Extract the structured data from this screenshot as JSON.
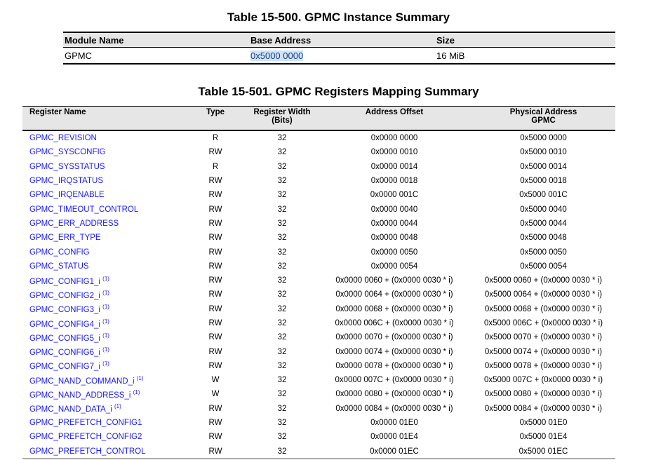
{
  "instance_table": {
    "title": "Table 15-500. GPMC Instance Summary",
    "headers": [
      "Module Name",
      "Base Address",
      "Size"
    ],
    "row": {
      "module": "GPMC",
      "base": "0x5000 0000",
      "size": "16 MiB"
    }
  },
  "mapping_table": {
    "title": "Table 15-501. GPMC Registers Mapping Summary",
    "headers": {
      "name": "Register Name",
      "type": "Type",
      "width_1": "Register Width",
      "width_2": "(Bits)",
      "offset": "Address Offset",
      "phys_1": "Physical Address",
      "phys_2": "GPMC"
    },
    "footnote_mark": "(1)",
    "rows": [
      {
        "name": "GPMC_REVISION",
        "fn": false,
        "type": "R",
        "width": "32",
        "offset": "0x0000 0000",
        "phys": "0x5000 0000"
      },
      {
        "name": "GPMC_SYSCONFIG",
        "fn": false,
        "type": "RW",
        "width": "32",
        "offset": "0x0000 0010",
        "phys": "0x5000 0010"
      },
      {
        "name": "GPMC_SYSSTATUS",
        "fn": false,
        "type": "R",
        "width": "32",
        "offset": "0x0000 0014",
        "phys": "0x5000 0014"
      },
      {
        "name": "GPMC_IRQSTATUS",
        "fn": false,
        "type": "RW",
        "width": "32",
        "offset": "0x0000 0018",
        "phys": "0x5000 0018"
      },
      {
        "name": "GPMC_IRQENABLE",
        "fn": false,
        "type": "RW",
        "width": "32",
        "offset": "0x0000 001C",
        "phys": "0x5000 001C"
      },
      {
        "name": "GPMC_TIMEOUT_CONTROL",
        "fn": false,
        "type": "RW",
        "width": "32",
        "offset": "0x0000 0040",
        "phys": "0x5000 0040"
      },
      {
        "name": "GPMC_ERR_ADDRESS",
        "fn": false,
        "type": "RW",
        "width": "32",
        "offset": "0x0000 0044",
        "phys": "0x5000 0044"
      },
      {
        "name": "GPMC_ERR_TYPE",
        "fn": false,
        "type": "RW",
        "width": "32",
        "offset": "0x0000 0048",
        "phys": "0x5000 0048"
      },
      {
        "name": "GPMC_CONFIG",
        "fn": false,
        "type": "RW",
        "width": "32",
        "offset": "0x0000 0050",
        "phys": "0x5000 0050"
      },
      {
        "name": "GPMC_STATUS",
        "fn": false,
        "type": "RW",
        "width": "32",
        "offset": "0x0000 0054",
        "phys": "0x5000 0054"
      },
      {
        "name": "GPMC_CONFIG1_i",
        "fn": true,
        "type": "RW",
        "width": "32",
        "offset": "0x0000 0060 + (0x0000 0030 * i)",
        "phys": "0x5000 0060 + (0x0000 0030 * i)"
      },
      {
        "name": "GPMC_CONFIG2_i",
        "fn": true,
        "type": "RW",
        "width": "32",
        "offset": "0x0000 0064 + (0x0000 0030 * i)",
        "phys": "0x5000 0064 + (0x0000 0030 * i)"
      },
      {
        "name": "GPMC_CONFIG3_i",
        "fn": true,
        "type": "RW",
        "width": "32",
        "offset": "0x0000 0068 + (0x0000 0030 * i)",
        "phys": "0x5000 0068 + (0x0000 0030 * i)"
      },
      {
        "name": "GPMC_CONFIG4_i",
        "fn": true,
        "type": "RW",
        "width": "32",
        "offset": "0x0000 006C + (0x0000 0030 * i)",
        "phys": "0x5000 006C + (0x0000 0030 * i)"
      },
      {
        "name": "GPMC_CONFIG5_i",
        "fn": true,
        "type": "RW",
        "width": "32",
        "offset": "0x0000 0070 + (0x0000 0030 * i)",
        "phys": "0x5000 0070 + (0x0000 0030 * i)"
      },
      {
        "name": "GPMC_CONFIG6_i",
        "fn": true,
        "type": "RW",
        "width": "32",
        "offset": "0x0000 0074 + (0x0000 0030 * i)",
        "phys": "0x5000 0074 + (0x0000 0030 * i)"
      },
      {
        "name": "GPMC_CONFIG7_i",
        "fn": true,
        "type": "RW",
        "width": "32",
        "offset": "0x0000 0078 + (0x0000 0030 * i)",
        "phys": "0x5000 0078 + (0x0000 0030 * i)"
      },
      {
        "name": "GPMC_NAND_COMMAND_i",
        "fn": true,
        "type": "W",
        "width": "32",
        "offset": "0x0000 007C + (0x0000 0030 * i)",
        "phys": "0x5000 007C + (0x0000 0030 * i)"
      },
      {
        "name": "GPMC_NAND_ADDRESS_i",
        "fn": true,
        "type": "W",
        "width": "32",
        "offset": "0x0000 0080 + (0x0000 0030 * i)",
        "phys": "0x5000 0080 + (0x0000 0030 * i)"
      },
      {
        "name": "GPMC_NAND_DATA_i",
        "fn": true,
        "type": "RW",
        "width": "32",
        "offset": "0x0000 0084 + (0x0000 0030 * i)",
        "phys": "0x5000 0084 + (0x0000 0030 * i)"
      },
      {
        "name": "GPMC_PREFETCH_CONFIG1",
        "fn": false,
        "type": "RW",
        "width": "32",
        "offset": "0x0000 01E0",
        "phys": "0x5000 01E0"
      },
      {
        "name": "GPMC_PREFETCH_CONFIG2",
        "fn": false,
        "type": "RW",
        "width": "32",
        "offset": "0x0000 01E4",
        "phys": "0x5000 01E4"
      },
      {
        "name": "GPMC_PREFETCH_CONTROL",
        "fn": false,
        "type": "RW",
        "width": "32",
        "offset": "0x0000 01EC",
        "phys": "0x5000 01EC"
      }
    ]
  }
}
